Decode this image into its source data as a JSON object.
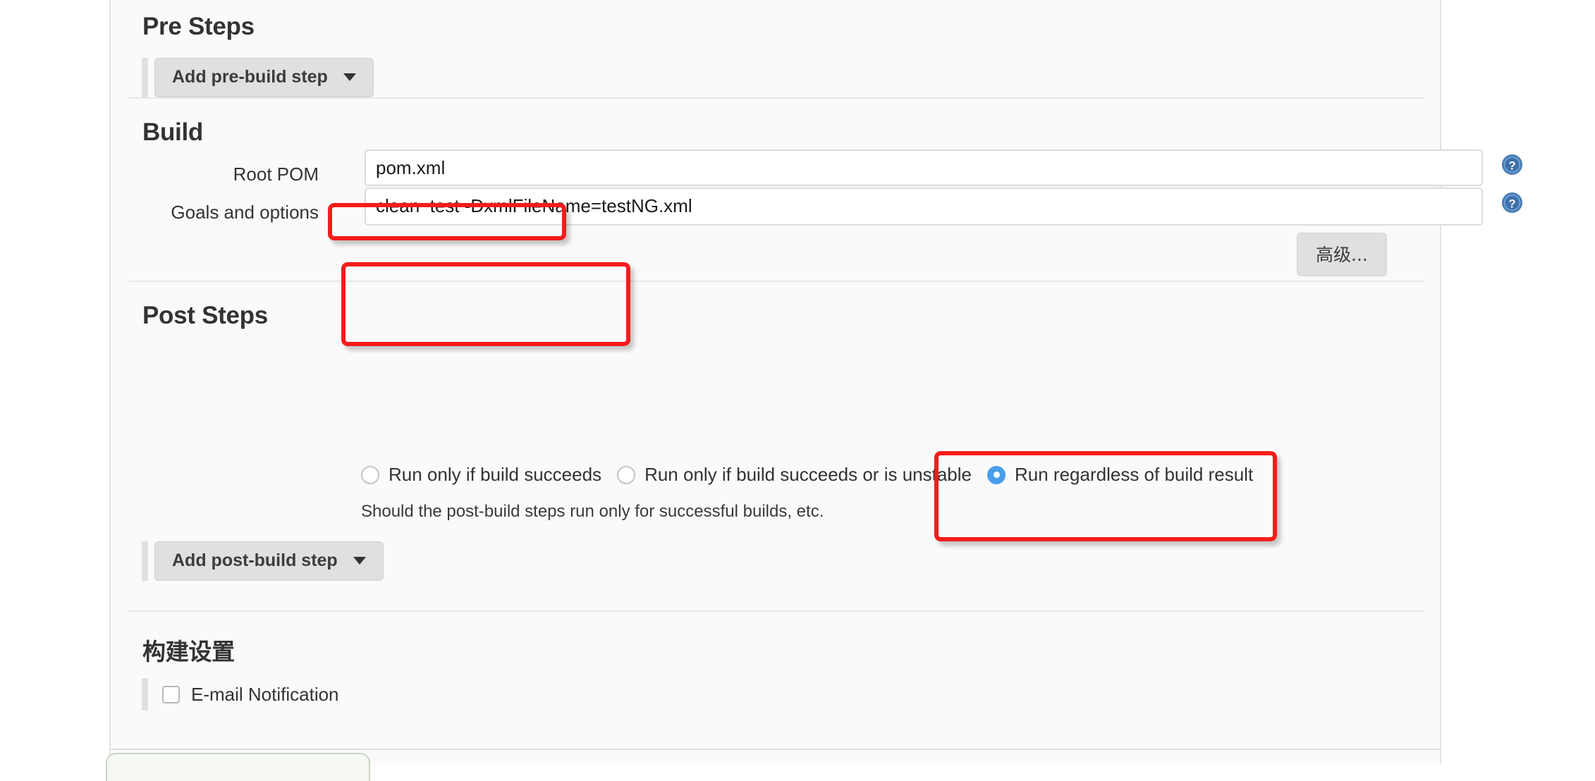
{
  "page": {
    "panel_bg": "#fafafa",
    "accent_radio": "#4a9eea",
    "annotation_color": "#f41c1c"
  },
  "pre_steps": {
    "title": "Pre Steps",
    "add_button": "Add pre-build step"
  },
  "build": {
    "title": "Build",
    "root_pom": {
      "label": "Root POM",
      "value": "pom.xml",
      "help_icon": "help-icon"
    },
    "goals": {
      "label": "Goals and options",
      "value": "clean  test -DxmlFileName=testNG.xml",
      "help_icon": "help-icon"
    },
    "advanced_button": "高级..."
  },
  "post_steps": {
    "title": "Post Steps",
    "options": [
      {
        "label": "Run only if build succeeds",
        "selected": false
      },
      {
        "label": "Run only if build succeeds or is unstable",
        "selected": false
      },
      {
        "label": "Run regardless of build result",
        "selected": true
      }
    ],
    "description": "Should the post-build steps run only for successful builds, etc.",
    "add_button": "Add post-build step"
  },
  "build_settings": {
    "title": "构建设置",
    "email_notification": {
      "label": "E-mail Notification",
      "checked": false
    }
  }
}
